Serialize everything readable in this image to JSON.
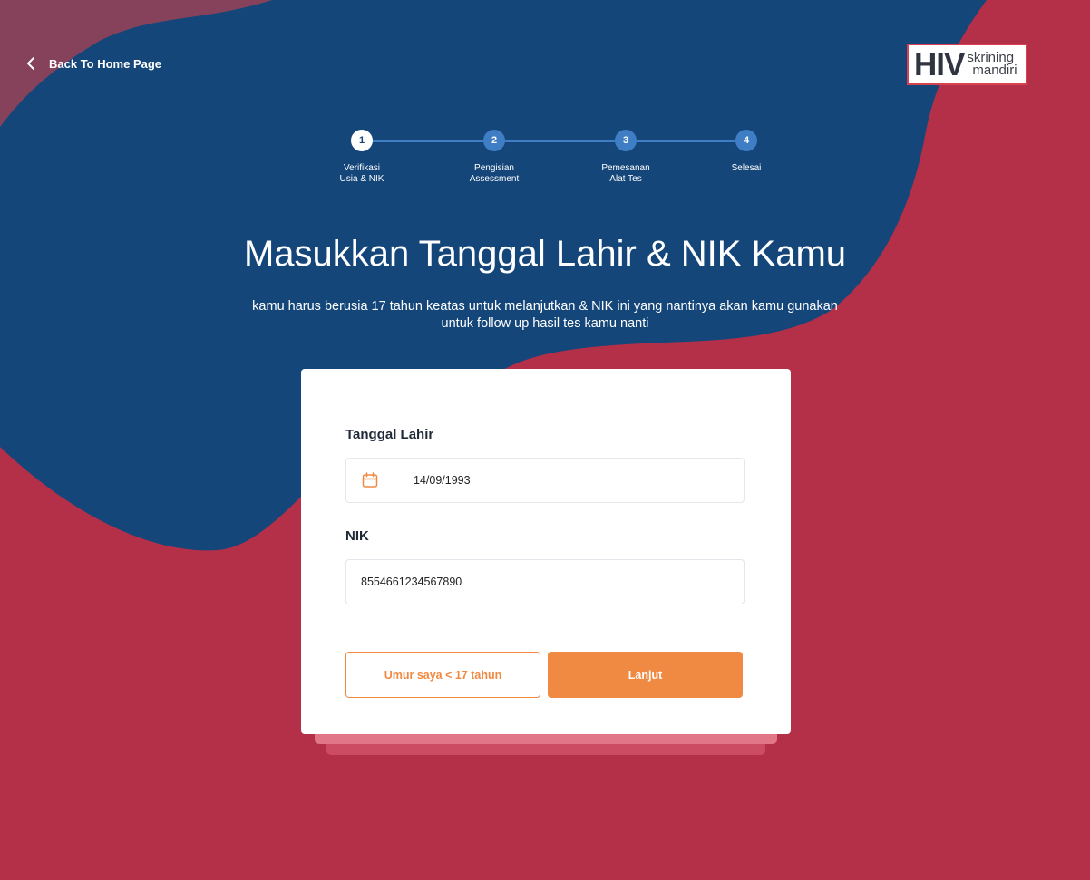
{
  "nav": {
    "back_label": "Back To Home Page"
  },
  "logo": {
    "hiv": "HIV",
    "line1": "skrining",
    "line2": "mandiri"
  },
  "stepper": {
    "steps": [
      {
        "number": "1",
        "label": "Verifikasi\nUsia & NIK",
        "active": true
      },
      {
        "number": "2",
        "label": "Pengisian\nAssessment",
        "active": false
      },
      {
        "number": "3",
        "label": "Pemesanan\nAlat Tes",
        "active": false
      },
      {
        "number": "4",
        "label": "Selesai",
        "active": false
      }
    ]
  },
  "header": {
    "title": "Masukkan Tanggal Lahir & NIK Kamu",
    "subtitle": "kamu harus berusia 17 tahun keatas untuk melanjutkan & NIK ini yang nantinya akan kamu gunakan untuk follow up hasil tes kamu nanti"
  },
  "form": {
    "dob_label": "Tanggal Lahir",
    "dob_value": "14/09/1993",
    "dob_icon": "calendar-icon",
    "nik_label": "NIK",
    "nik_value": "8554661234567890"
  },
  "actions": {
    "underage_label": "Umur saya < 17 tahun",
    "continue_label": "Lanjut"
  },
  "colors": {
    "navy": "#14467a",
    "crimson": "#b42f48",
    "accent_orange": "#f08a43",
    "step_blue": "#3f7dc4"
  }
}
